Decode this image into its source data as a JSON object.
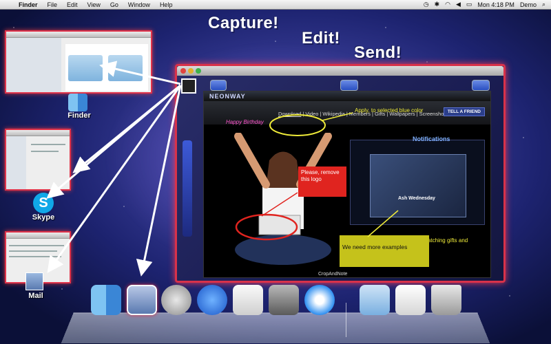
{
  "menubar": {
    "app_name": "Finder",
    "items": [
      "File",
      "Edit",
      "View",
      "Go",
      "Window",
      "Help"
    ],
    "clock": "Mon 4:18 PM",
    "user": "Demo"
  },
  "headlines": {
    "capture": "Capture!",
    "edit": "Edit!",
    "send": "Send!"
  },
  "targets": {
    "finder": "Finder",
    "skype": "Skype",
    "mail": "Mail"
  },
  "web": {
    "brand": "NEONWAY",
    "happy_birthday": "Happy Birthday",
    "nav_links": [
      "Download",
      "Video",
      "Wikipedia",
      "Members",
      "Gifts",
      "Wallpapers",
      "Screenshots"
    ],
    "tell_friend": "TELL A FRIEND",
    "notifications_title": "Notifications",
    "ash": "Ash Wednesday",
    "body_text": "Remind you on birthdays and matching gifts and more..."
  },
  "annotations": {
    "apply_note": "Apply, to selected blue color",
    "remove_logo": "Please, remove this logo",
    "more_examples": "We need more examples",
    "caption": "CropAndNote"
  },
  "colors": {
    "accent_red": "#d8324a",
    "note_red": "#e0241f",
    "note_yellow": "#c5c21b",
    "annotation_text": "#f0ec3a"
  }
}
